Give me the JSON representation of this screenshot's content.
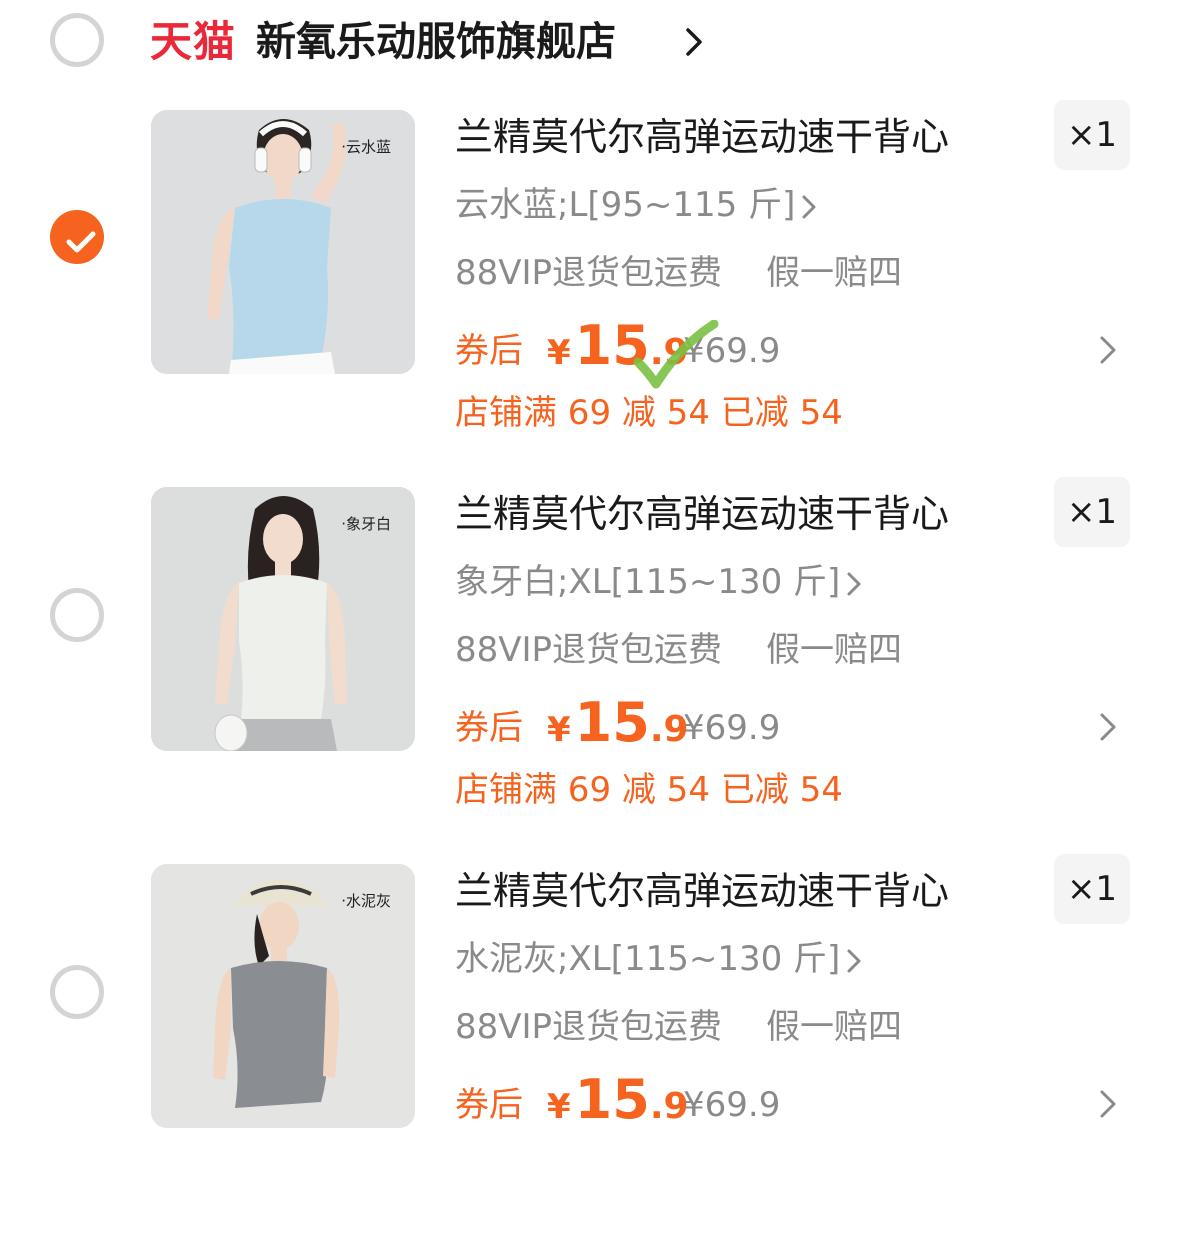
{
  "shop": {
    "brand": "天猫",
    "name": "新氧乐动服饰旗舰店",
    "selected": false
  },
  "items": [
    {
      "thumb_label": "·云水蓝",
      "shirt_color": "#b7d7ea",
      "title": "兰精莫代尔高弹运动速干背心",
      "sku": "云水蓝;L[95~115 斤]",
      "service_1": "88VIP退货包运费",
      "service_2": "假一赔四",
      "coupon_label": "券后",
      "price_symbol": "¥",
      "price_int": "15",
      "price_dec": ".9",
      "orig_price": "¥69.9",
      "discount": "店铺满 69 减 54 已减 54",
      "qty": "×1",
      "selected": true
    },
    {
      "thumb_label": "·象牙白",
      "shirt_color": "#eef0ec",
      "title": "兰精莫代尔高弹运动速干背心",
      "sku": "象牙白;XL[115~130 斤]",
      "service_1": "88VIP退货包运费",
      "service_2": "假一赔四",
      "coupon_label": "券后",
      "price_symbol": "¥",
      "price_int": "15",
      "price_dec": ".9",
      "orig_price": "¥69.9",
      "discount": "店铺满 69 减 54 已减 54",
      "qty": "×1",
      "selected": false
    },
    {
      "thumb_label": "·水泥灰",
      "shirt_color": "#8a8d91",
      "title": "兰精莫代尔高弹运动速干背心",
      "sku": "水泥灰;XL[115~130 斤]",
      "service_1": "88VIP退货包运费",
      "service_2": "假一赔四",
      "coupon_label": "券后",
      "price_symbol": "¥",
      "price_int": "15",
      "price_dec": ".9",
      "orig_price": "¥69.9",
      "discount": "",
      "qty": "×1",
      "selected": false
    }
  ],
  "colors": {
    "accent": "#f5631f",
    "tmall_red": "#ea2838",
    "muted_text": "#8a8a8a",
    "annotation_green": "#7bc043"
  }
}
